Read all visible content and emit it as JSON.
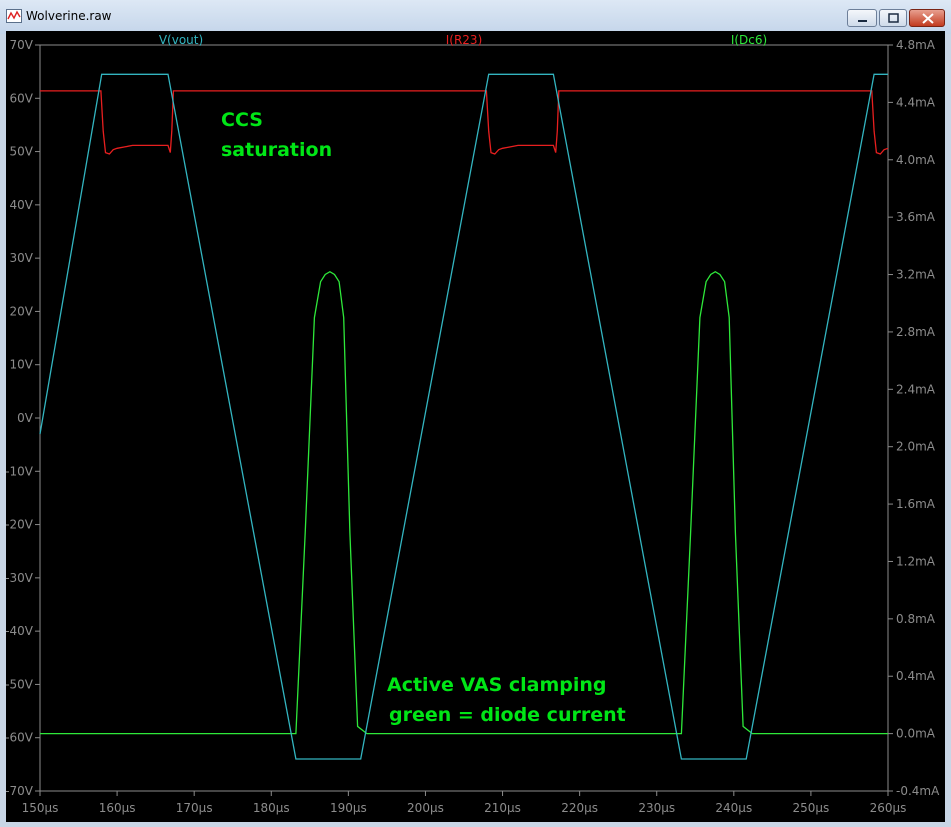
{
  "window": {
    "title": "Wolverine.raw"
  },
  "colors": {
    "vout": "#33b5c0",
    "ir23": "#e81f1f",
    "idc6": "#2ee83a",
    "axis": "#8c8c8c",
    "annotation": "#00e616"
  },
  "chart_data": {
    "type": "line",
    "title": "",
    "xlabel": "",
    "x_ticks": [
      "150µs",
      "160µs",
      "170µs",
      "180µs",
      "190µs",
      "200µs",
      "210µs",
      "220µs",
      "230µs",
      "240µs",
      "250µs",
      "260µs"
    ],
    "xlim": [
      150,
      260
    ],
    "x_unit": "µs",
    "left_axis": {
      "ylim": [
        -70,
        70
      ],
      "ticks": [
        "70V",
        "60V",
        "50V",
        "40V",
        "30V",
        "20V",
        "10V",
        "0V",
        "-10V",
        "-20V",
        "-30V",
        "-40V",
        "-50V",
        "-60V",
        "-70V"
      ]
    },
    "right_axis": {
      "ylim": [
        -0.4,
        4.8
      ],
      "ticks": [
        "4.8mA",
        "4.4mA",
        "4.0mA",
        "3.6mA",
        "3.2mA",
        "2.8mA",
        "2.4mA",
        "2.0mA",
        "1.6mA",
        "1.2mA",
        "0.8mA",
        "0.4mA",
        "0.0mA",
        "-0.4mA"
      ]
    },
    "grid": false,
    "series": [
      {
        "name": "V(vout)",
        "axis": "left",
        "unit": "V",
        "x": [
          150,
          158,
          166.6,
          183.2,
          191.6,
          208.2,
          216.6,
          233.2,
          241.6,
          258.2,
          260
        ],
        "y": [
          -3,
          64.5,
          64.5,
          -64,
          -64,
          64.5,
          64.5,
          -64,
          -64,
          64.5,
          64.5
        ]
      },
      {
        "name": "I(R23)",
        "axis": "right",
        "unit": "mA",
        "x": [
          150,
          157.9,
          158.2,
          158.5,
          159.0,
          159.5,
          160,
          161,
          162,
          166.6,
          166.9,
          167.1,
          167.3,
          183.2,
          207.9,
          208.2,
          208.5,
          209.0,
          209.5,
          210,
          211,
          212,
          216.6,
          216.9,
          217.1,
          217.3,
          257.9,
          258.2,
          258.5,
          259,
          259.5,
          260
        ],
        "y": [
          4.48,
          4.48,
          4.2,
          4.05,
          4.04,
          4.07,
          4.08,
          4.09,
          4.1,
          4.1,
          4.05,
          4.2,
          4.48,
          4.48,
          4.48,
          4.2,
          4.05,
          4.04,
          4.07,
          4.08,
          4.09,
          4.1,
          4.1,
          4.05,
          4.2,
          4.48,
          4.48,
          4.2,
          4.05,
          4.04,
          4.07,
          4.08
        ]
      },
      {
        "name": "I(Dc6)",
        "axis": "right",
        "unit": "mA",
        "x": [
          150,
          183.2,
          184.4,
          185.6,
          186.4,
          187,
          187.6,
          188.2,
          188.8,
          189.4,
          190.2,
          191.2,
          192.4,
          233.2,
          234.4,
          235.6,
          236.4,
          237,
          237.6,
          238.2,
          238.8,
          239.4,
          240.2,
          241.2,
          242.4,
          260
        ],
        "y": [
          0,
          0,
          1.4,
          2.9,
          3.15,
          3.2,
          3.22,
          3.2,
          3.15,
          2.9,
          1.4,
          0.05,
          0,
          0,
          1.4,
          2.9,
          3.15,
          3.2,
          3.22,
          3.2,
          3.15,
          2.9,
          1.4,
          0.05,
          0,
          0
        ]
      }
    ],
    "annotations": [
      {
        "lines": [
          "CCS",
          "saturation"
        ]
      },
      {
        "lines": [
          "Active VAS clamping",
          "green = diode current"
        ]
      }
    ]
  }
}
